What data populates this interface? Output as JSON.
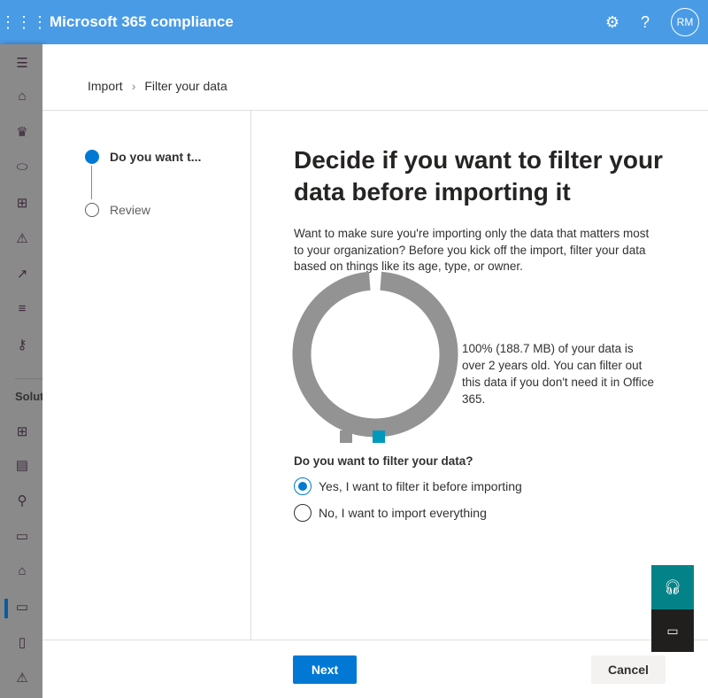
{
  "header": {
    "title": "Microsoft 365 compliance",
    "avatar": "RM",
    "icons": [
      "waffle-icon",
      "settings-icon",
      "help-icon"
    ]
  },
  "sidebar": {
    "section_label": "Solutions",
    "icons": [
      "hamburger-icon",
      "home-icon",
      "trophy-icon",
      "tag-icon",
      "workflow-icon",
      "alert-icon",
      "chart-icon",
      "sliders-icon",
      "key-icon",
      "catalog-add-icon",
      "document-search-icon",
      "search-icon",
      "chat-icon",
      "bank-search-icon",
      "archive-icon",
      "device-lock-icon",
      "user-warning-icon"
    ],
    "active_index": 14
  },
  "breadcrumb": [
    "Import",
    "Filter your data"
  ],
  "steps": [
    {
      "label": "Do you want t...",
      "state": "current"
    },
    {
      "label": "Review",
      "state": "pending"
    }
  ],
  "main": {
    "heading": "Decide if you want to filter your data before importing it",
    "description": "Want to make sure you're importing only the data that matters most to your organization? Before you kick off the import, filter your data based on things like its age, type, or owner.",
    "chart_text": "100% (188.7 MB) of your data is over 2 years old. You can filter out this data if you don't need it in Office 365.",
    "question": "Do you want to filter your data?",
    "options": [
      {
        "label": "Yes, I want to filter it before importing",
        "selected": true
      },
      {
        "label": "No, I want to import everything",
        "selected": false
      }
    ]
  },
  "chart_data": {
    "type": "pie",
    "donut": true,
    "slices": [
      {
        "value": 100,
        "color": "#939393"
      },
      {
        "value": 0,
        "color": "#0099bc"
      }
    ]
  },
  "footer": {
    "next": "Next",
    "cancel": "Cancel"
  }
}
